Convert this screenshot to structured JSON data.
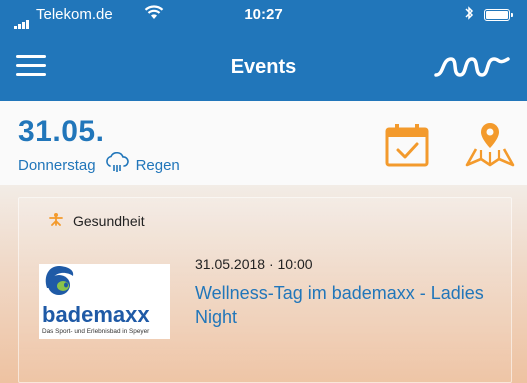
{
  "status_bar": {
    "carrier": "Telekom.de",
    "time": "10:27"
  },
  "nav": {
    "title": "Events",
    "brand_icon": "sws-logo-icon"
  },
  "date_header": {
    "date": "31.05.",
    "weekday": "Donnerstag",
    "weather": "Regen"
  },
  "colors": {
    "primary": "#2176ba",
    "accent": "#f39a2c"
  },
  "events": [
    {
      "category": "Gesundheit",
      "datetime": "31.05.2018 · 10:00",
      "title": "Wellness-Tag im bademaxx - Ladies Night",
      "image": {
        "brand": "bademaxx",
        "tagline": "Das Sport- und Erlebnisbad in Speyer"
      }
    }
  ]
}
